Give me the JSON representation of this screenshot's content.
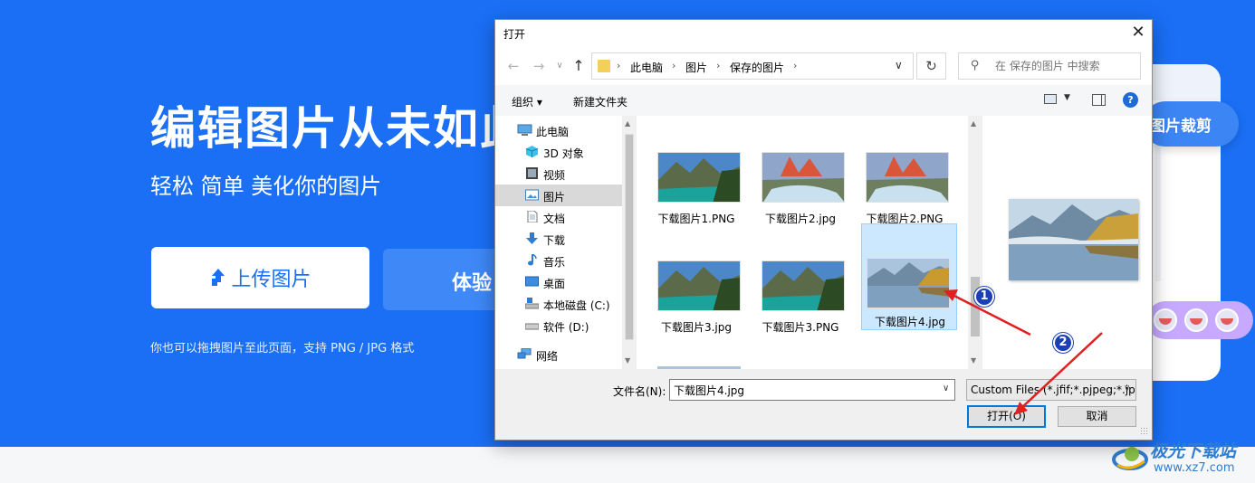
{
  "page": {
    "hero_title": "编辑图片从未如此",
    "hero_subtitle": "轻松 简单 美化你的图片",
    "upload_button": "上传图片",
    "try_button": "体验",
    "hint": "你也可以拖拽图片至此页面，支持 PNG / JPG 格式",
    "crop_label": "图片裁剪",
    "brand_color": "#1a6ff5"
  },
  "watermark": {
    "name": "极光下载站",
    "url": "www.xz7.com"
  },
  "dialog": {
    "title": "打开",
    "close_glyph": "✕",
    "breadcrumbs": [
      "此电脑",
      "图片",
      "保存的图片"
    ],
    "search_placeholder": "在 保存的图片 中搜索",
    "toolbar": {
      "organize": "组织 ▾",
      "new_folder": "新建文件夹",
      "help": "?"
    },
    "nav_items": [
      {
        "label": "此电脑",
        "icon": "computer-icon"
      },
      {
        "label": "3D 对象",
        "icon": "cube-icon"
      },
      {
        "label": "视频",
        "icon": "video-icon"
      },
      {
        "label": "图片",
        "icon": "picture-icon",
        "selected": true
      },
      {
        "label": "文档",
        "icon": "document-icon"
      },
      {
        "label": "下载",
        "icon": "download-icon"
      },
      {
        "label": "音乐",
        "icon": "music-icon"
      },
      {
        "label": "桌面",
        "icon": "desktop-icon"
      },
      {
        "label": "本地磁盘 (C:)",
        "icon": "drive-c-icon"
      },
      {
        "label": "软件 (D:)",
        "icon": "drive-d-icon"
      },
      {
        "label": "网络",
        "icon": "network-icon"
      }
    ],
    "files": [
      {
        "name": "下载图片1.PNG",
        "scene": "lake"
      },
      {
        "name": "下载图片2.jpg",
        "scene": "stream"
      },
      {
        "name": "下载图片2.PNG",
        "scene": "stream"
      },
      {
        "name": "下载图片3.jpg",
        "scene": "lake"
      },
      {
        "name": "下载图片3.PNG",
        "scene": "lake"
      },
      {
        "name": "下载图片4.jpg",
        "scene": "misty",
        "selected": true
      }
    ],
    "filename_label": "文件名(N):",
    "filename_value": "下载图片4.jpg",
    "filetype_value": "Custom Files (*.jfif;*.pjpeg;*.jpeg",
    "open_button": "打开(O)",
    "cancel_button": "取消"
  },
  "annotations": {
    "step1": "1",
    "step2": "2",
    "arrow_color": "#e02020"
  }
}
